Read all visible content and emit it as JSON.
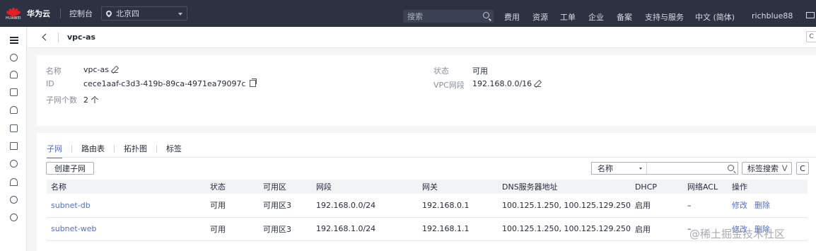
{
  "topbar": {
    "logo_text": "HUAWEI",
    "brand": "华为云",
    "console": "控制台",
    "region": "北京四",
    "search_placeholder": "搜索",
    "nav": [
      "费用",
      "资源",
      "工单",
      "企业",
      "备案",
      "支持与服务",
      "中文 (简体)",
      "richblue88"
    ]
  },
  "breadcrumb": {
    "title": "vpc-as",
    "refresh": "C"
  },
  "info": {
    "name_label": "名称",
    "name_value": "vpc-as",
    "id_label": "ID",
    "id_value": "cece1aaf-c3d3-419b-89ca-4971ea79097c",
    "subnet_count_label": "子网个数",
    "subnet_count_value": "2 个",
    "status_label": "状态",
    "status_value": "可用",
    "cidr_label": "VPC网段",
    "cidr_value": "192.168.0.0/16"
  },
  "tabs": [
    "子网",
    "路由表",
    "拓扑图",
    "标签"
  ],
  "toolbar": {
    "create_label": "创建子网",
    "filter_field": "名称",
    "tag_search_label": "标签搜索",
    "refresh_label": "C"
  },
  "table": {
    "headers": [
      "名称",
      "状态",
      "可用区",
      "网段",
      "网关",
      "DNS服务器地址",
      "DHCP",
      "网络ACL",
      "操作"
    ],
    "rows": [
      {
        "name": "subnet-db",
        "status": "可用",
        "az": "可用区3",
        "cidr": "192.168.0.0/24",
        "gateway": "192.168.0.1",
        "dns": "100.125.1.250, 100.125.129.250",
        "dhcp": "启用",
        "acl": "–",
        "modify": "修改",
        "delete": "删除"
      },
      {
        "name": "subnet-web",
        "status": "可用",
        "az": "可用区3",
        "cidr": "192.168.1.0/24",
        "gateway": "192.168.1.1",
        "dns": "100.125.1.250, 100.125.129.250",
        "dhcp": "启用",
        "acl": "–",
        "modify": "修改",
        "delete": "删除"
      }
    ]
  },
  "watermark": "@稀土掘金技术社区",
  "colors": {
    "topbar_bg": "#2d3142",
    "accent": "#526ecc",
    "logo_red": "#e31e24"
  }
}
